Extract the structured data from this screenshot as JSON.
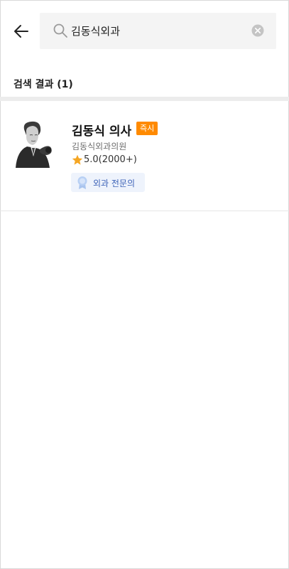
{
  "search": {
    "query": "김동식외과",
    "placeholder": ""
  },
  "results": {
    "section_title": "검색 결과 (1)",
    "items": [
      {
        "name": "김동식 의사",
        "badge": "즉시",
        "clinic": "김동식외과의원",
        "rating": "5.0(2000+)",
        "specialty": "외과 전문의"
      }
    ]
  },
  "colors": {
    "badge": "#ff8a00",
    "star": "#f5a623",
    "chip_bg": "#eef3fc",
    "chip_text": "#3d63b8"
  },
  "icons": [
    "back-arrow-icon",
    "search-icon",
    "clear-icon",
    "star-icon",
    "medal-icon"
  ]
}
